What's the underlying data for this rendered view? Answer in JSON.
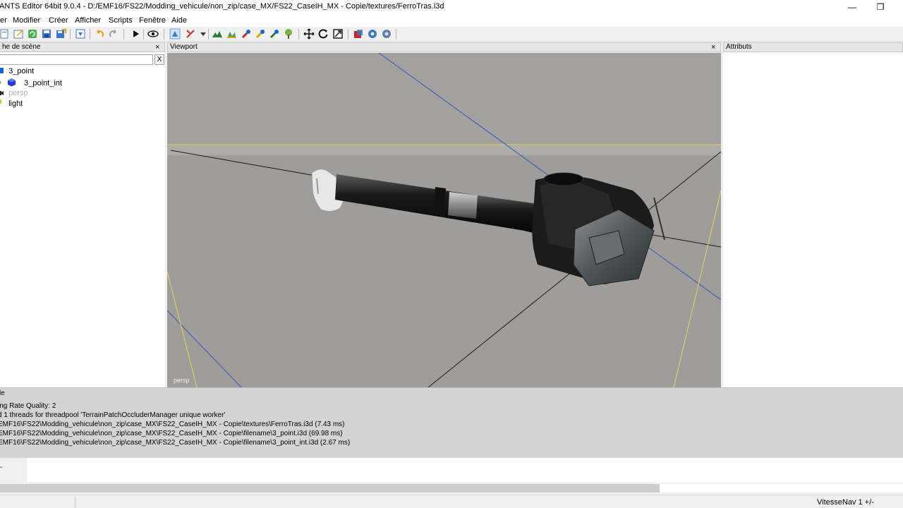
{
  "window": {
    "title": "ANTS Editor 64bit 9.0.4 - D:/EMF16/FS22/Modding_vehicule/non_zip/case_MX/FS22_CaseIH_MX - Copie/textures/FerroTras.i3d",
    "minimize": "—",
    "restore": "❐"
  },
  "menu": [
    "er",
    "Modifier",
    "Créer",
    "Afficher",
    "Scripts",
    "Fenêtre",
    "Aide"
  ],
  "scene_panel": {
    "title": "he de scène",
    "close": "×",
    "clear_button": "X",
    "items": [
      {
        "label": "3_point",
        "color": "#1565d8"
      },
      {
        "label": "3_point_int",
        "color": "#1e3bd8"
      },
      {
        "label": "persp",
        "color": "#b4b4b4"
      },
      {
        "label": "light",
        "color": "#f0c400"
      }
    ]
  },
  "viewport_panel": {
    "title": "Viewport",
    "close": "×",
    "camera_label": "persp",
    "background": "#a09e9b",
    "horizon_color": "#e8d35a"
  },
  "attributes_panel": {
    "title": "Attributs"
  },
  "console": {
    "title": "le",
    "lines": [
      "ing Rate Quality: 2",
      "d 1 threads for threadpool 'TerrainPatchOccluderManager unique worker'",
      "EMF16\\FS22\\Modding_vehicule\\non_zip\\case_MX\\FS22_CaseIH_MX - Copie\\textures\\FerroTras.i3d (7.43 ms)",
      "EMF16\\FS22\\Modding_vehicule\\non_zip\\case_MX\\FS22_CaseIH_MX - Copie\\filename\\3_point.i3d (69.98 ms)",
      "EMF16\\FS22\\Modding_vehicule\\non_zip\\case_MX\\FS22_CaseIH_MX - Copie\\filename\\3_point_int.i3d (2.67 ms)"
    ],
    "prompt": "-"
  },
  "status": {
    "nav_speed": "VitesseNav 1 +/-"
  },
  "toolbar_icons": [
    "new-icon",
    "open-icon",
    "edit-icon",
    "refresh-icon",
    "save-icon",
    "export-icon",
    "import-icon",
    "undo-icon",
    "redo-icon",
    "play-icon",
    "view-icon",
    "camera-icon",
    "select-icon",
    "dropdown-icon",
    "terrain-paint-icon",
    "foliage-icon",
    "brush-icon",
    "spray-icon",
    "paint-icon",
    "tree-icon",
    "move-icon",
    "rotate-icon",
    "scale-icon",
    "shape-icon",
    "settings-icon",
    "gear-icon"
  ]
}
